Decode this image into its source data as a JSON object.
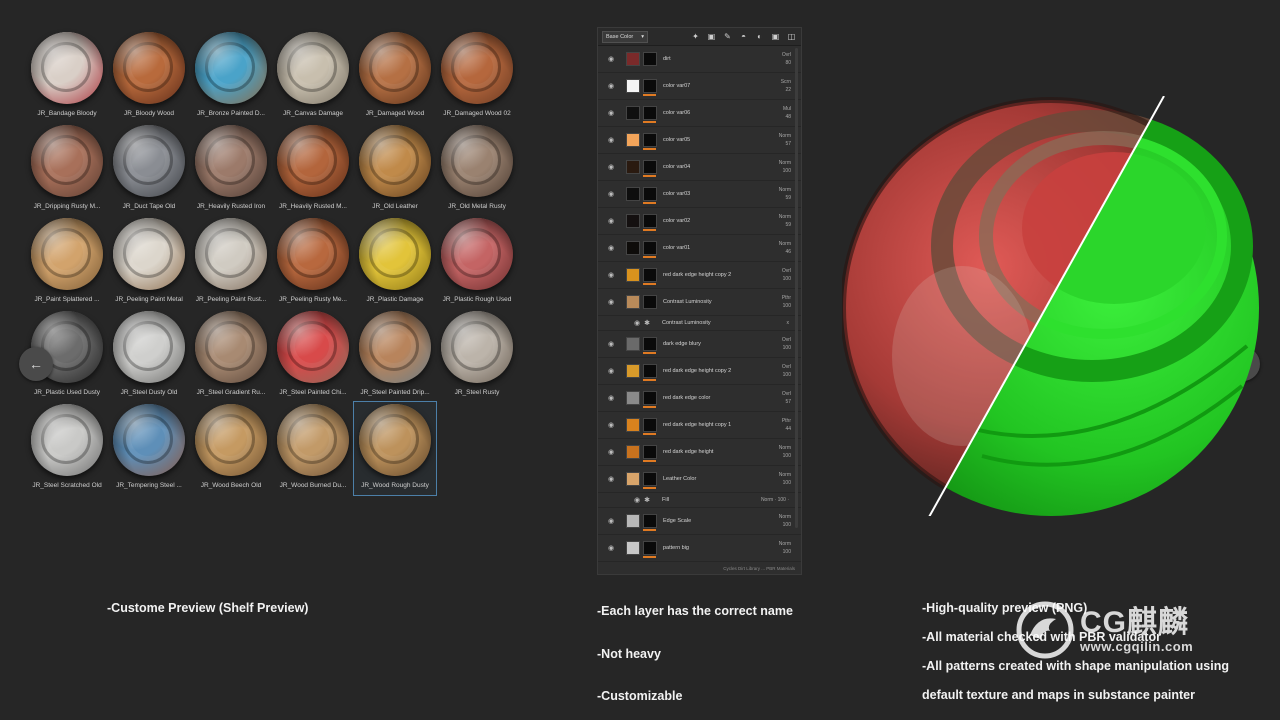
{
  "shelf": {
    "materials": [
      {
        "label": "JR_Bandage Bloody",
        "c1": "#d9cfc7",
        "c2": "#a8323a"
      },
      {
        "label": "JR_Bloody Wood",
        "c1": "#b86a3c",
        "c2": "#5c2a18"
      },
      {
        "label": "JR_Bronze Painted D...",
        "c1": "#4aa3c9",
        "c2": "#8a6a48"
      },
      {
        "label": "JR_Canvas Damage",
        "c1": "#c8bfae",
        "c2": "#7a7264"
      },
      {
        "label": "JR_Damaged Wood",
        "c1": "#b57044",
        "c2": "#5a3018"
      },
      {
        "label": "JR_Damaged Wood 02",
        "c1": "#b5673d",
        "c2": "#6a3a22"
      },
      {
        "label": "JR_Dripping Rusty M...",
        "c1": "#a8705a",
        "c2": "#5a3c30"
      },
      {
        "label": "JR_Duct Tape Old",
        "c1": "#8a8d93",
        "c2": "#3c3f44"
      },
      {
        "label": "JR_Heavily Rusted Iron",
        "c1": "#9c7a6a",
        "c2": "#4a3830"
      },
      {
        "label": "JR_Heavily Rusted M...",
        "c1": "#b3653c",
        "c2": "#5e2c16"
      },
      {
        "label": "JR_Old Leather",
        "c1": "#c08a4a",
        "c2": "#5e3c1c"
      },
      {
        "label": "JR_Old Metal Rusty",
        "c1": "#9a8270",
        "c2": "#4a3a30"
      },
      {
        "label": "JR_Paint Splattered ...",
        "c1": "#d2a36c",
        "c2": "#7a5a34"
      },
      {
        "label": "JR_Peeling Paint Metal",
        "c1": "#dcd6cc",
        "c2": "#8a6a4a"
      },
      {
        "label": "JR_Peeling Paint Rust...",
        "c1": "#d0cbc2",
        "c2": "#7e6a58"
      },
      {
        "label": "JR_Peeling Rusty Me...",
        "c1": "#b8683e",
        "c2": "#5a2c18"
      },
      {
        "label": "JR_Plastic Damage",
        "c1": "#e2c43a",
        "c2": "#8a7414"
      },
      {
        "label": "JR_Plastic Rough Used",
        "c1": "#c46464",
        "c2": "#6a2c2c"
      },
      {
        "label": "JR_Plastic Used Dusty",
        "c1": "#6c6c6c",
        "c2": "#222222"
      },
      {
        "label": "JR_Steel Dusty Old",
        "c1": "#cfcfcd",
        "c2": "#6a6a68"
      },
      {
        "label": "JR_Steel Gradient Ru...",
        "c1": "#a88a72",
        "c2": "#584438"
      },
      {
        "label": "JR_Steel Painted Chi...",
        "c1": "#d84a4a",
        "c2": "#8a6a5a"
      },
      {
        "label": "JR_Steel Painted Drip...",
        "c1": "#b8845c",
        "c2": "#6a7e88"
      },
      {
        "label": "JR_Steel Rusty",
        "c1": "#bcb4aa",
        "c2": "#6a5e52"
      },
      {
        "label": "JR_Steel Scratched Old",
        "c1": "#c9c9c7",
        "c2": "#6a6a6a"
      },
      {
        "label": "JR_Tempering Steel ...",
        "c1": "#5e8fb8",
        "c2": "#8a5a48"
      },
      {
        "label": "JR_Wood Beech Old",
        "c1": "#c59a62",
        "c2": "#6e5030"
      },
      {
        "label": "JR_Wood Burned Du...",
        "c1": "#c29a68",
        "c2": "#6a4e34"
      },
      {
        "label": "JR_Wood Rough Dusty",
        "c1": "#bd925c",
        "c2": "#5e4428"
      }
    ]
  },
  "layer_panel": {
    "channel": "Base Color",
    "layers": [
      {
        "name": "dirt",
        "blend": "Ovrl",
        "opacity": "80",
        "thumb": "#7a2a2a",
        "line": false
      },
      {
        "name": "color var07",
        "blend": "Scrn",
        "opacity": "22",
        "thumb": "#f4f4f4",
        "line": true
      },
      {
        "name": "color var06",
        "blend": "Mul",
        "opacity": "48",
        "thumb": "#101010",
        "line": true
      },
      {
        "name": "color var05",
        "blend": "Norm",
        "opacity": "57",
        "thumb": "#f2a45a",
        "line": true
      },
      {
        "name": "color var04",
        "blend": "Norm",
        "opacity": "100",
        "thumb": "#2a1a10",
        "line": true
      },
      {
        "name": "color var03",
        "blend": "Norm",
        "opacity": "59",
        "thumb": "#0e0e0e",
        "line": true
      },
      {
        "name": "color var02",
        "blend": "Norm",
        "opacity": "59",
        "thumb": "#141010",
        "line": true
      },
      {
        "name": "color var01",
        "blend": "Norm",
        "opacity": "46",
        "thumb": "#0e0c0a",
        "line": true
      },
      {
        "name": "red dark edge height copy 2",
        "blend": "Ovrl",
        "opacity": "100",
        "thumb": "#d8921e",
        "line": true
      },
      {
        "name": "Contrast Luminosity",
        "blend": "Pthr",
        "opacity": "100",
        "thumb": "#b88a5a",
        "line": false
      },
      {
        "name": "Contrast Luminosity",
        "sub": true,
        "meta": "x"
      },
      {
        "name": "dark edge blury",
        "blend": "Ovrl",
        "opacity": "100",
        "thumb": "#6a6a6a",
        "line": true
      },
      {
        "name": "red dark edge height copy 2",
        "blend": "Ovrl",
        "opacity": "100",
        "thumb": "#d89a2a",
        "line": true
      },
      {
        "name": "red dark edge color",
        "blend": "Ovrl",
        "opacity": "57",
        "thumb": "#8a8a8a",
        "line": true
      },
      {
        "name": "red dark edge height copy 1",
        "blend": "Pthr",
        "opacity": "44",
        "thumb": "#d8821e",
        "line": true
      },
      {
        "name": "red dark edge height",
        "blend": "Norm",
        "opacity": "100",
        "thumb": "#c8721e",
        "line": true
      },
      {
        "name": "Leather Color",
        "blend": "Norm",
        "opacity": "100",
        "thumb": "#d8a46a",
        "line": true
      },
      {
        "name": "Fill",
        "sub": true,
        "meta": "Norm · 100 ·"
      },
      {
        "name": "Edge Scale",
        "blend": "Norm",
        "opacity": "100",
        "thumb": "#b8b8b8",
        "line": true
      },
      {
        "name": "pattern big",
        "blend": "Norm",
        "opacity": "100",
        "thumb": "#c8c8c8",
        "line": true
      }
    ],
    "footer": "Cycles Dirt Library ... PBR Materials"
  },
  "captions": {
    "shelf": "-Custome Preview (Shelf Preview)",
    "name": "-Each layer has the correct name",
    "heavy": "-Not heavy",
    "custom": "-Customizable",
    "png": "-High-quality preview (PNG)",
    "pbr": "-All material checked with PBR validator",
    "pattern": "-All patterns created with shape manipulation using",
    "default": "default texture and maps in substance painter"
  },
  "watermark": {
    "brand": "CG麒麟",
    "url": "www.cgqilin.com"
  },
  "icons": {
    "nav_left": "←",
    "nav_right": "→",
    "eye": "◉"
  },
  "colors": {
    "background": "#262626",
    "preview_green": "#2bd62b",
    "preview_red": "#c8403e",
    "accent_orange": "#e07a22"
  }
}
